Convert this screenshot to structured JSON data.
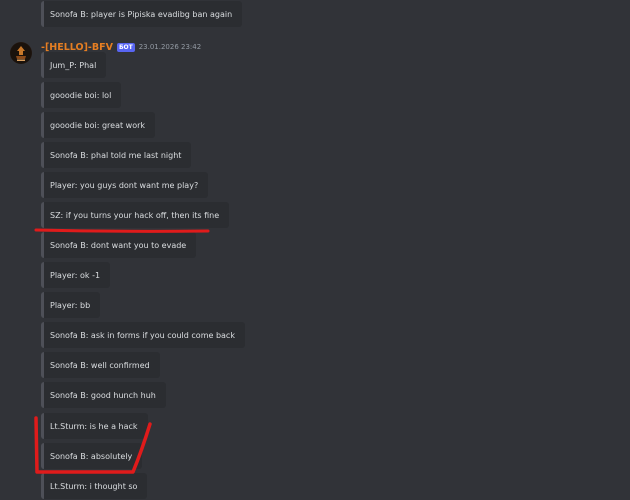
{
  "message": {
    "username": "-[HELLO]-BFV",
    "badge": "БОТ",
    "timestamp": "23.01.2026 23:42"
  },
  "top_embed": "Sonofa B: player is Pipiska evadibg ban again",
  "embeds": [
    "Jum_P: Phal",
    "gooodie boi: lol",
    "gooodie boi: great work",
    "Sonofa B: phal told me last night",
    "Player: you guys dont want me play?",
    "SZ: if you turns your hack off, then its fine",
    "Sonofa B: dont want you to evade",
    "Player: ok -1",
    "Player: bb",
    "Sonofa B: ask in forms if you could come back",
    "Sonofa B: well confirmed",
    "Sonofa B: good hunch huh",
    "Lt.Sturm: is he a hack",
    "Sonofa B: absolutely",
    "Lt.Sturm: i thought so"
  ],
  "colors": {
    "background": "#313338",
    "embed_background": "#2b2d31",
    "embed_border": "#4e5058",
    "username": "#e67e22",
    "bot_badge": "#5865f2",
    "annotation": "#e01b1b"
  },
  "icons": {
    "avatar": "server-logo-avatar"
  }
}
